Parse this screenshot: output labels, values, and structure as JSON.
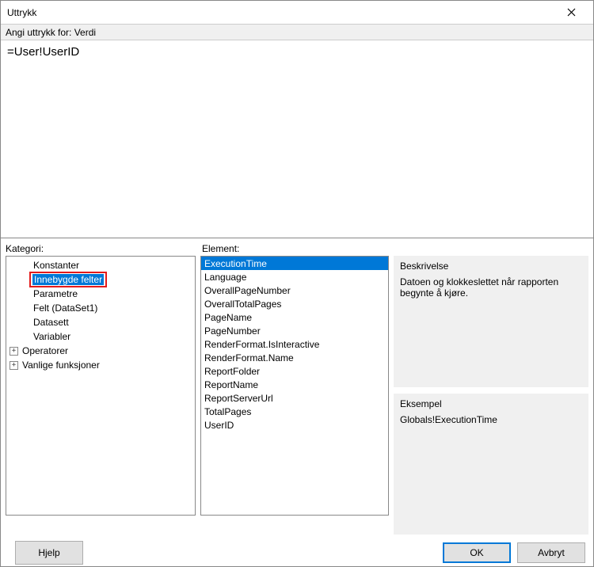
{
  "window": {
    "title": "Uttrykk"
  },
  "expression": {
    "label": "Angi uttrykk for: Verdi",
    "value": "=User!UserID"
  },
  "labels": {
    "category": "Kategori:",
    "element": "Element:",
    "description": "Beskrivelse",
    "example": "Eksempel"
  },
  "categories": {
    "items": [
      {
        "label": "Konstanter",
        "indent": 1,
        "expand": ""
      },
      {
        "label": "Innebygde felter",
        "indent": 1,
        "expand": "",
        "selected": true,
        "highlighted": true
      },
      {
        "label": "Parametre",
        "indent": 1,
        "expand": ""
      },
      {
        "label": "Felt (DataSet1)",
        "indent": 1,
        "expand": ""
      },
      {
        "label": "Datasett",
        "indent": 1,
        "expand": ""
      },
      {
        "label": "Variabler",
        "indent": 1,
        "expand": ""
      },
      {
        "label": "Operatorer",
        "indent": 0,
        "expand": "+"
      },
      {
        "label": "Vanlige funksjoner",
        "indent": 0,
        "expand": "+"
      }
    ]
  },
  "elements": {
    "items": [
      {
        "label": "ExecutionTime",
        "selected": true
      },
      {
        "label": "Language"
      },
      {
        "label": "OverallPageNumber"
      },
      {
        "label": "OverallTotalPages"
      },
      {
        "label": "PageName"
      },
      {
        "label": "PageNumber"
      },
      {
        "label": "RenderFormat.IsInteractive"
      },
      {
        "label": "RenderFormat.Name"
      },
      {
        "label": "ReportFolder"
      },
      {
        "label": "ReportName"
      },
      {
        "label": "ReportServerUrl"
      },
      {
        "label": "TotalPages"
      },
      {
        "label": "UserID"
      }
    ]
  },
  "description": {
    "text": "Datoen og klokkeslettet når rapporten begynte å kjøre."
  },
  "example": {
    "text": "Globals!ExecutionTime"
  },
  "buttons": {
    "help": "Hjelp",
    "ok": "OK",
    "cancel": "Avbryt"
  }
}
